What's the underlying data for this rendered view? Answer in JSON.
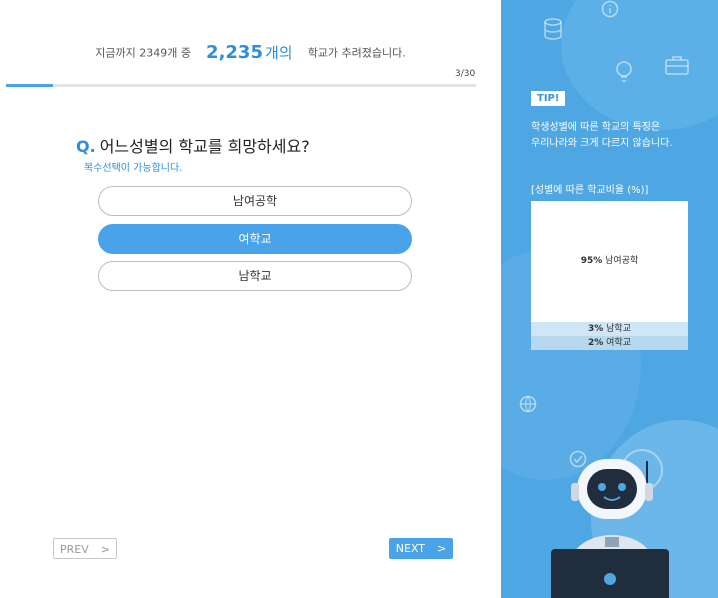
{
  "progress": {
    "prefix": "지금까지 2349개 중",
    "count": "2,235",
    "unit": "개의",
    "suffix": "학교가 추려졌습니다.",
    "step": "3/30",
    "fraction": 0.1
  },
  "question": {
    "marker": "Q.",
    "text": "어느성별의 학교를 희망하세요?",
    "hint": "복수선택이 가능합니다."
  },
  "options": [
    {
      "label": "남여공학",
      "selected": false
    },
    {
      "label": "여학교",
      "selected": true
    },
    {
      "label": "남학교",
      "selected": false
    }
  ],
  "nav": {
    "prev": "PREV",
    "next": "NEXT",
    "arrow": ">"
  },
  "tip": {
    "badge": "TIP!",
    "line1": "학생성별에 따른 학교의 특징은",
    "line2": "우리나라와 크게 다르지 않습니다.",
    "chart_title": "[성별에 따른 학교비율 (%)]"
  },
  "chart_data": {
    "type": "bar",
    "categories": [
      "남여공학",
      "남학교",
      "여학교"
    ],
    "values": [
      95,
      3,
      2
    ],
    "labels": [
      "95%",
      "3%",
      "2%"
    ],
    "title": "[성별에 따른 학교비율 (%)]"
  },
  "colors": {
    "accent": "#4aa3e8",
    "side_bg": "#4ea6e3"
  }
}
